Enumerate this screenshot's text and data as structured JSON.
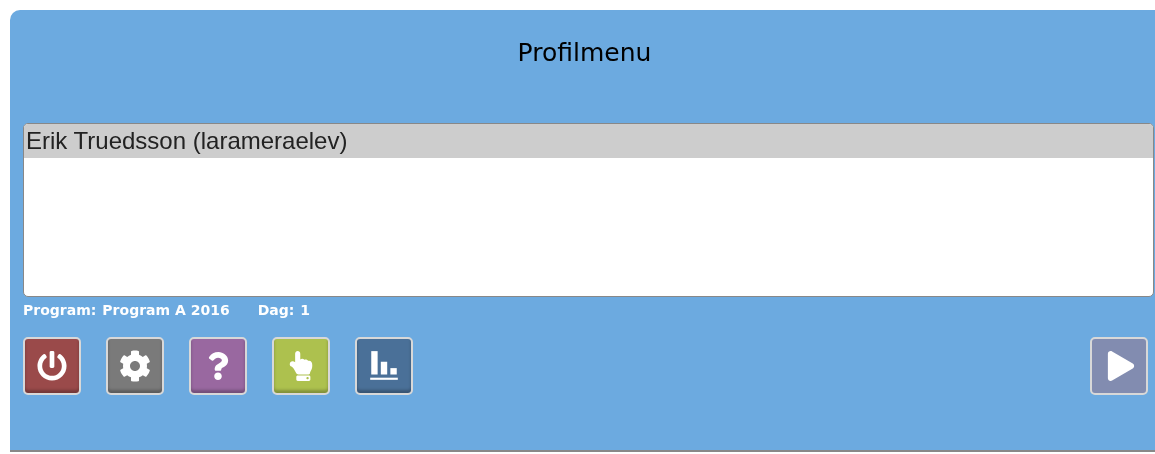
{
  "title": "Profilmenu",
  "profiles": [
    {
      "label": "Erik Truedsson (larameraelev)",
      "selected": true
    }
  ],
  "info": [
    {
      "label": "Program:",
      "value": "Program A 2016"
    },
    {
      "label": "Dag:",
      "value": "1"
    }
  ],
  "tools": [
    {
      "kind": "power",
      "color": "#9a4a4a"
    },
    {
      "kind": "settings",
      "color": "#7a7a7a"
    },
    {
      "kind": "help",
      "color": "#9968a0"
    },
    {
      "kind": "hand",
      "color": "#adc14e"
    },
    {
      "kind": "chart",
      "color": "#4a7098"
    }
  ],
  "next": {
    "color": "#828cb0"
  }
}
